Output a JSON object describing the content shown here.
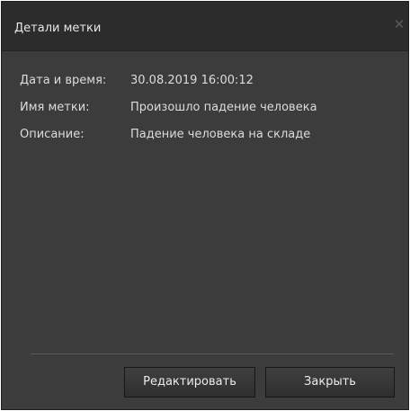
{
  "dialog": {
    "title": "Детали метки",
    "close_icon": "close-icon"
  },
  "details": [
    {
      "label": "Дата и время:",
      "value": "30.08.2019 16:00:12"
    },
    {
      "label": "Имя метки:",
      "value": "Произошло падение человека"
    },
    {
      "label": "Описание:",
      "value": "Падение человека на складе"
    }
  ],
  "buttons": {
    "edit_label": "Редактировать",
    "close_label": "Закрыть"
  },
  "colors": {
    "background": "#3c3c3c",
    "titlebar": "#2c2c2c",
    "text": "#dcdcdc"
  }
}
